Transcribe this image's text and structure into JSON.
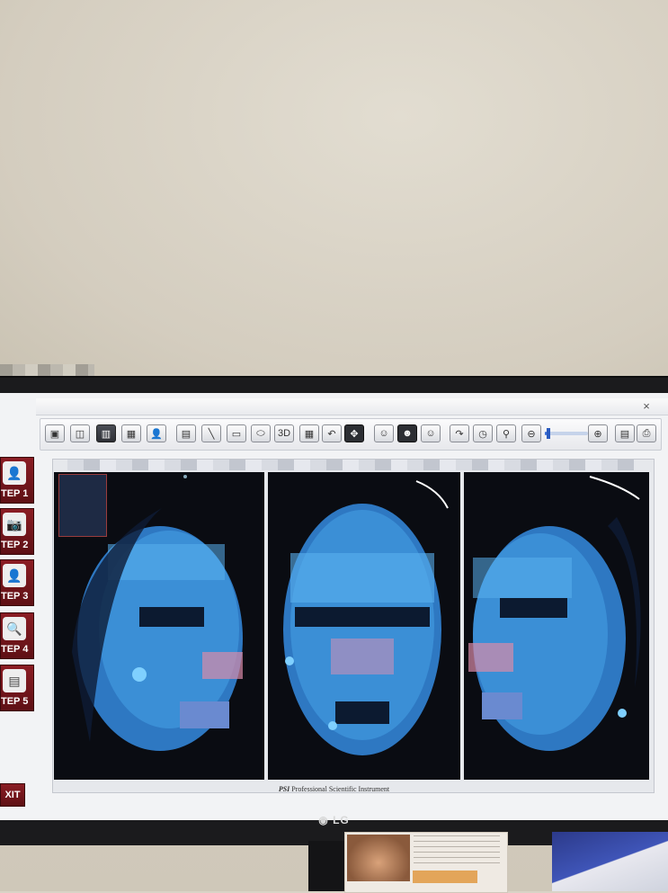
{
  "screen": {
    "close_glyph": "×"
  },
  "toolbar": {
    "buttons": [
      {
        "name": "image-icon",
        "glyph": "▣"
      },
      {
        "name": "split-view-icon",
        "glyph": "◫"
      },
      {
        "name": "triple-view-icon",
        "glyph": "▥",
        "active": true
      },
      {
        "name": "quad-view-icon",
        "glyph": "▦"
      },
      {
        "name": "user-icon",
        "glyph": "👤"
      },
      {
        "name": "label-icon",
        "glyph": "▤"
      },
      {
        "name": "line-tool-icon",
        "glyph": "╲"
      },
      {
        "name": "rectangle-tool-icon",
        "glyph": "▭"
      },
      {
        "name": "ellipse-tool-icon",
        "glyph": "⬭"
      },
      {
        "name": "3d-button",
        "glyph": "3D"
      },
      {
        "name": "grid-icon",
        "glyph": "▦"
      },
      {
        "name": "undo-icon",
        "glyph": "↶"
      },
      {
        "name": "move-icon",
        "glyph": "✥",
        "dark": true
      },
      {
        "name": "face-left-icon",
        "glyph": "☺"
      },
      {
        "name": "face-front-icon",
        "glyph": "☻",
        "dark": true
      },
      {
        "name": "face-right-icon",
        "glyph": "☺"
      },
      {
        "name": "redo-icon",
        "glyph": "↷"
      },
      {
        "name": "timer-icon",
        "glyph": "◷"
      },
      {
        "name": "face-search-icon",
        "glyph": "⚲"
      },
      {
        "name": "zoom-out-icon",
        "glyph": "⊖"
      },
      {
        "name": "zoom-in-icon",
        "glyph": "⊕"
      },
      {
        "name": "save-icon",
        "glyph": "▤"
      },
      {
        "name": "print-icon",
        "glyph": "⎙"
      }
    ],
    "zoom_level": 0.05
  },
  "sidebar": {
    "steps": [
      {
        "label": "TEP 1",
        "icon": "add-user-icon",
        "glyph": "👤"
      },
      {
        "label": "TEP 2",
        "icon": "camera-icon",
        "glyph": "📷"
      },
      {
        "label": "TEP 3",
        "icon": "person-icon",
        "glyph": "👤"
      },
      {
        "label": "TEP 4",
        "icon": "search-icon",
        "glyph": "🔍"
      },
      {
        "label": "TEP 5",
        "icon": "report-icon",
        "glyph": "▤"
      }
    ],
    "exit_label": "XIT"
  },
  "footer": {
    "brand": "PSI",
    "text": "Professional Scientific Instrument"
  },
  "monitor": {
    "brand": "LG",
    "logo_glyph": "◉"
  },
  "colors": {
    "accent": "#8b1d24",
    "face_blue": "#3b8fd6",
    "panel_bg": "#0a0c12"
  }
}
